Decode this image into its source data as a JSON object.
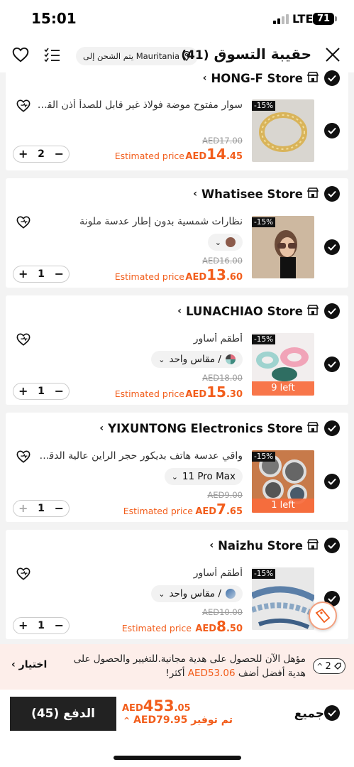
{
  "status": {
    "time": "15:01",
    "network": "LTE",
    "battery": "71"
  },
  "header": {
    "title": "حقيبة التسوق",
    "count": "(41)",
    "shipping": "يتم الشحن إلى Mauritania"
  },
  "items": [
    {
      "store": "HONG-F Store",
      "title": "سوار مفتوح موضة فولاذ غير قابل للصدأ أذن القمر",
      "discount": "-15%",
      "old_price": "AED17.00",
      "estimated_label": "Estimated price",
      "price_currency": "AED",
      "price_int": "14",
      "price_dec": ".45",
      "qty": "2",
      "variant": ""
    },
    {
      "store": "Whatisee Store",
      "title": "نظارات شمسية بدون إطار عدسة ملونة",
      "discount": "-15%",
      "old_price": "AED16.00",
      "estimated_label": "Estimated price",
      "price_currency": "AED",
      "price_int": "13",
      "price_dec": ".60",
      "qty": "1",
      "variant": ""
    },
    {
      "store": "LUNACHIAO Store",
      "title": "أطقم أساور",
      "discount": "-15%",
      "old_price": "AED18.00",
      "estimated_label": "Estimated price",
      "price_currency": "AED",
      "price_int": "15",
      "price_dec": ".30",
      "qty": "1",
      "variant": "/ مقاس واحد",
      "stock": "9 left"
    },
    {
      "store": "YIXUNTONG Electronics Store",
      "title": "واقي عدسة هاتف بديكور حجر الراين عالية الدقة غ",
      "discount": "-15%",
      "old_price": "AED9.00",
      "estimated_label": "Estimated price",
      "price_currency": "AED",
      "price_int": "7",
      "price_dec": ".65",
      "qty": "1",
      "variant": "11 Pro Max",
      "stock": "1 left"
    },
    {
      "store": "Naizhu Store",
      "title": "أطقم أساور",
      "discount": "-15%",
      "old_price": "AED10.00",
      "estimated_label": "Estimated price",
      "price_currency": "AED",
      "price_int": "8",
      "price_dec": ".50",
      "qty": "1",
      "variant": "/ مقاس واحد"
    }
  ],
  "gift": {
    "count": "2",
    "line1": "مؤهل الآن للحصول على هدية مجانية.للتغيير والحصول على",
    "line2_prefix": "هدية أفضل أضف ",
    "line2_amount": "AED53.06",
    "line2_suffix": " أكثر!",
    "choose": "اختيار"
  },
  "bottom": {
    "pay_label": "الدفع (45)",
    "total_currency": "AED",
    "total_int": "453",
    "total_dec": ".05",
    "saving_label": "تم توفير",
    "saving_amount": "AED79.95",
    "all_label": "جميع"
  },
  "colors": {
    "accent": "#f25d1b",
    "dark": "#222222",
    "gift_bg": "#fdeeea"
  }
}
